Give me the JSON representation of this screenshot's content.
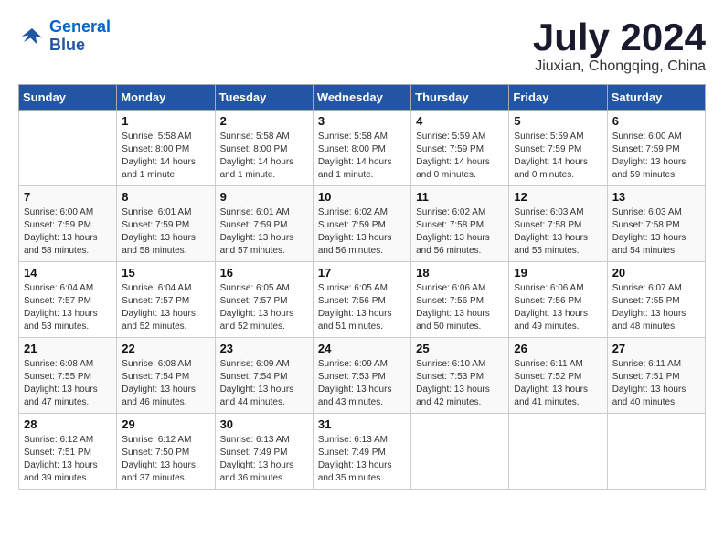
{
  "header": {
    "logo_line1": "General",
    "logo_line2": "Blue",
    "month_title": "July 2024",
    "location": "Jiuxian, Chongqing, China"
  },
  "weekdays": [
    "Sunday",
    "Monday",
    "Tuesday",
    "Wednesday",
    "Thursday",
    "Friday",
    "Saturday"
  ],
  "weeks": [
    [
      {
        "day": "",
        "sunrise": "",
        "sunset": "",
        "daylight": ""
      },
      {
        "day": "1",
        "sunrise": "Sunrise: 5:58 AM",
        "sunset": "Sunset: 8:00 PM",
        "daylight": "Daylight: 14 hours and 1 minute."
      },
      {
        "day": "2",
        "sunrise": "Sunrise: 5:58 AM",
        "sunset": "Sunset: 8:00 PM",
        "daylight": "Daylight: 14 hours and 1 minute."
      },
      {
        "day": "3",
        "sunrise": "Sunrise: 5:58 AM",
        "sunset": "Sunset: 8:00 PM",
        "daylight": "Daylight: 14 hours and 1 minute."
      },
      {
        "day": "4",
        "sunrise": "Sunrise: 5:59 AM",
        "sunset": "Sunset: 7:59 PM",
        "daylight": "Daylight: 14 hours and 0 minutes."
      },
      {
        "day": "5",
        "sunrise": "Sunrise: 5:59 AM",
        "sunset": "Sunset: 7:59 PM",
        "daylight": "Daylight: 14 hours and 0 minutes."
      },
      {
        "day": "6",
        "sunrise": "Sunrise: 6:00 AM",
        "sunset": "Sunset: 7:59 PM",
        "daylight": "Daylight: 13 hours and 59 minutes."
      }
    ],
    [
      {
        "day": "7",
        "sunrise": "Sunrise: 6:00 AM",
        "sunset": "Sunset: 7:59 PM",
        "daylight": "Daylight: 13 hours and 58 minutes."
      },
      {
        "day": "8",
        "sunrise": "Sunrise: 6:01 AM",
        "sunset": "Sunset: 7:59 PM",
        "daylight": "Daylight: 13 hours and 58 minutes."
      },
      {
        "day": "9",
        "sunrise": "Sunrise: 6:01 AM",
        "sunset": "Sunset: 7:59 PM",
        "daylight": "Daylight: 13 hours and 57 minutes."
      },
      {
        "day": "10",
        "sunrise": "Sunrise: 6:02 AM",
        "sunset": "Sunset: 7:59 PM",
        "daylight": "Daylight: 13 hours and 56 minutes."
      },
      {
        "day": "11",
        "sunrise": "Sunrise: 6:02 AM",
        "sunset": "Sunset: 7:58 PM",
        "daylight": "Daylight: 13 hours and 56 minutes."
      },
      {
        "day": "12",
        "sunrise": "Sunrise: 6:03 AM",
        "sunset": "Sunset: 7:58 PM",
        "daylight": "Daylight: 13 hours and 55 minutes."
      },
      {
        "day": "13",
        "sunrise": "Sunrise: 6:03 AM",
        "sunset": "Sunset: 7:58 PM",
        "daylight": "Daylight: 13 hours and 54 minutes."
      }
    ],
    [
      {
        "day": "14",
        "sunrise": "Sunrise: 6:04 AM",
        "sunset": "Sunset: 7:57 PM",
        "daylight": "Daylight: 13 hours and 53 minutes."
      },
      {
        "day": "15",
        "sunrise": "Sunrise: 6:04 AM",
        "sunset": "Sunset: 7:57 PM",
        "daylight": "Daylight: 13 hours and 52 minutes."
      },
      {
        "day": "16",
        "sunrise": "Sunrise: 6:05 AM",
        "sunset": "Sunset: 7:57 PM",
        "daylight": "Daylight: 13 hours and 52 minutes."
      },
      {
        "day": "17",
        "sunrise": "Sunrise: 6:05 AM",
        "sunset": "Sunset: 7:56 PM",
        "daylight": "Daylight: 13 hours and 51 minutes."
      },
      {
        "day": "18",
        "sunrise": "Sunrise: 6:06 AM",
        "sunset": "Sunset: 7:56 PM",
        "daylight": "Daylight: 13 hours and 50 minutes."
      },
      {
        "day": "19",
        "sunrise": "Sunrise: 6:06 AM",
        "sunset": "Sunset: 7:56 PM",
        "daylight": "Daylight: 13 hours and 49 minutes."
      },
      {
        "day": "20",
        "sunrise": "Sunrise: 6:07 AM",
        "sunset": "Sunset: 7:55 PM",
        "daylight": "Daylight: 13 hours and 48 minutes."
      }
    ],
    [
      {
        "day": "21",
        "sunrise": "Sunrise: 6:08 AM",
        "sunset": "Sunset: 7:55 PM",
        "daylight": "Daylight: 13 hours and 47 minutes."
      },
      {
        "day": "22",
        "sunrise": "Sunrise: 6:08 AM",
        "sunset": "Sunset: 7:54 PM",
        "daylight": "Daylight: 13 hours and 46 minutes."
      },
      {
        "day": "23",
        "sunrise": "Sunrise: 6:09 AM",
        "sunset": "Sunset: 7:54 PM",
        "daylight": "Daylight: 13 hours and 44 minutes."
      },
      {
        "day": "24",
        "sunrise": "Sunrise: 6:09 AM",
        "sunset": "Sunset: 7:53 PM",
        "daylight": "Daylight: 13 hours and 43 minutes."
      },
      {
        "day": "25",
        "sunrise": "Sunrise: 6:10 AM",
        "sunset": "Sunset: 7:53 PM",
        "daylight": "Daylight: 13 hours and 42 minutes."
      },
      {
        "day": "26",
        "sunrise": "Sunrise: 6:11 AM",
        "sunset": "Sunset: 7:52 PM",
        "daylight": "Daylight: 13 hours and 41 minutes."
      },
      {
        "day": "27",
        "sunrise": "Sunrise: 6:11 AM",
        "sunset": "Sunset: 7:51 PM",
        "daylight": "Daylight: 13 hours and 40 minutes."
      }
    ],
    [
      {
        "day": "28",
        "sunrise": "Sunrise: 6:12 AM",
        "sunset": "Sunset: 7:51 PM",
        "daylight": "Daylight: 13 hours and 39 minutes."
      },
      {
        "day": "29",
        "sunrise": "Sunrise: 6:12 AM",
        "sunset": "Sunset: 7:50 PM",
        "daylight": "Daylight: 13 hours and 37 minutes."
      },
      {
        "day": "30",
        "sunrise": "Sunrise: 6:13 AM",
        "sunset": "Sunset: 7:49 PM",
        "daylight": "Daylight: 13 hours and 36 minutes."
      },
      {
        "day": "31",
        "sunrise": "Sunrise: 6:13 AM",
        "sunset": "Sunset: 7:49 PM",
        "daylight": "Daylight: 13 hours and 35 minutes."
      },
      {
        "day": "",
        "sunrise": "",
        "sunset": "",
        "daylight": ""
      },
      {
        "day": "",
        "sunrise": "",
        "sunset": "",
        "daylight": ""
      },
      {
        "day": "",
        "sunrise": "",
        "sunset": "",
        "daylight": ""
      }
    ]
  ]
}
